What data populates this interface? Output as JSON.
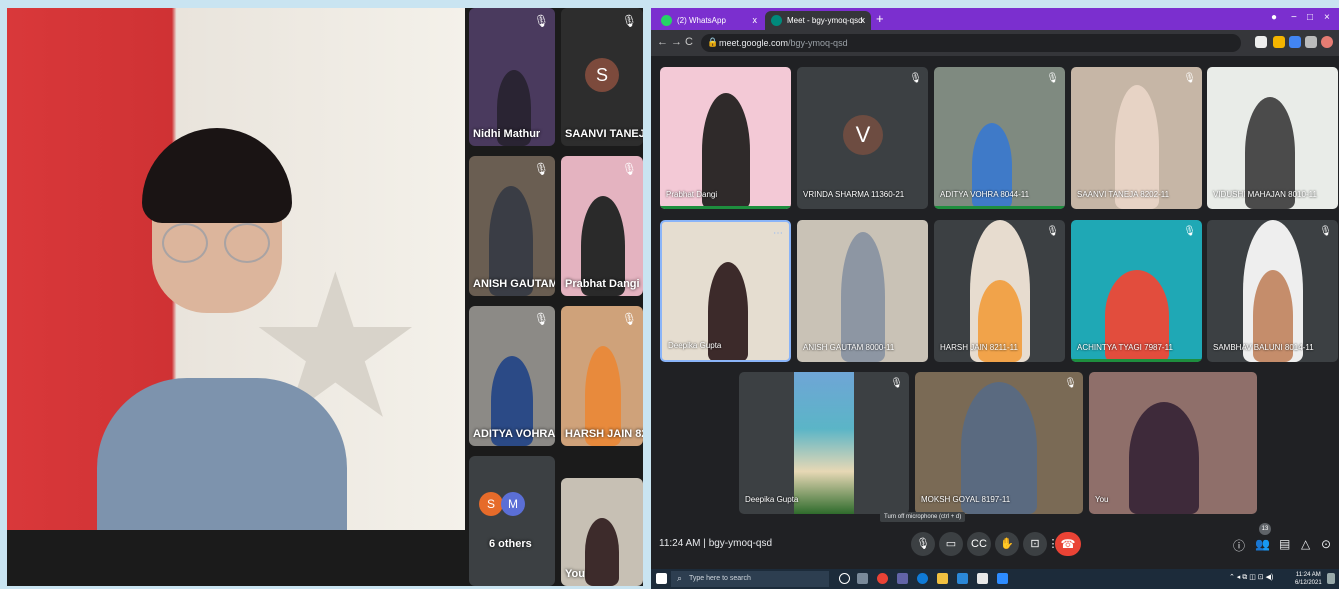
{
  "left_panel": {
    "tiles": [
      {
        "name": "Nidhi Mathur"
      },
      {
        "name": "SAANVI TANEJA ...",
        "initial": "S"
      },
      {
        "name": "ANISH GAUTAM ..."
      },
      {
        "name": "Prabhat Dangi"
      },
      {
        "name": "ADITYA VOHRA ..."
      },
      {
        "name": "HARSH JAIN 821..."
      },
      {
        "name": "6 others",
        "initials": [
          "S",
          "M"
        ]
      },
      {
        "name": "You"
      }
    ]
  },
  "browser": {
    "tabs": [
      {
        "label": "(2) WhatsApp",
        "close": "x"
      },
      {
        "label": "Meet - bgy-ymoq-qsd",
        "close": "x",
        "active": true
      }
    ],
    "new_tab": "+",
    "url_host": "meet.google.com",
    "url_path": "/bgy-ymoq-qsd",
    "window_controls": [
      "−",
      "□",
      "×"
    ]
  },
  "meet": {
    "participants": [
      {
        "name": "Prabhat Dangi"
      },
      {
        "name": "VRINDA SHARMA 11360-21",
        "initial": "V"
      },
      {
        "name": "ADITYA VOHRA 8044-11"
      },
      {
        "name": "SAANVI TANEJA 8202-11"
      },
      {
        "name": "VIDUSHI MAHAJAN 8010-11"
      },
      {
        "name": "Deepika Gupta"
      },
      {
        "name": "ANISH GAUTAM 8000-11"
      },
      {
        "name": "HARSH JAIN 8211-11"
      },
      {
        "name": "ACHINTYA TYAGI 7987-11"
      },
      {
        "name": "SAMBHAV BALUNI 8014-11"
      },
      {
        "name": "Deepika Gupta"
      },
      {
        "name": "MOKSH GOYAL 8197-11"
      },
      {
        "name": "You"
      }
    ],
    "time": "11:24 AM",
    "separator": "|",
    "meeting_code": "bgy-ymoq-qsd",
    "tooltip": "Turn off microphone (ctrl + d)",
    "participant_count": "13",
    "icons": [
      "microphone-icon",
      "camera-icon",
      "captions-icon",
      "raise-hand-icon",
      "present-icon",
      "more-options-icon",
      "end-call-icon",
      "info-icon",
      "people-icon",
      "chat-icon",
      "activities-icon",
      "host-controls-icon"
    ]
  },
  "taskbar": {
    "search_placeholder": "Type here to search",
    "clock_time": "11:24 AM",
    "clock_date": "6/12/2021"
  },
  "colors": {
    "accent_purple": "#7b2fcf",
    "meet_bg": "#202124",
    "tile_bg": "#3c4043",
    "end_call_red": "#ea4335",
    "speaking_green": "#1e8e3e"
  }
}
